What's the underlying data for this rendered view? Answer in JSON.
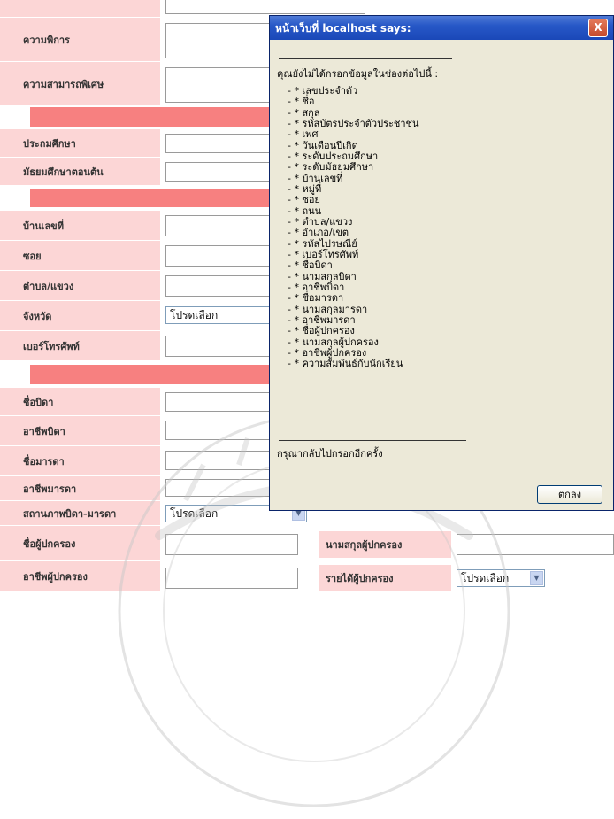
{
  "form": {
    "labels": {
      "disability": "ความพิการ",
      "special_ability": "ความสามารถพิเศษ",
      "primary": "ประถมศึกษา",
      "lower_secondary": "มัธยมศึกษาตอนต้น",
      "house_no": "บ้านเลขที่",
      "soi": "ซอย",
      "subdistrict": "ตำบล/แขวง",
      "province": "จังหวัด",
      "phone": "เบอร์โทรศัพท์",
      "father_name": "ชื่อบิดา",
      "father_occupation": "อาชีพบิดา",
      "mother_name": "ชื่อมารดา",
      "mother_occupation": "อาชีพมารดา",
      "parents_status": "สถานภาพบิดา-มารดา",
      "guardian_name": "ชื่อผู้ปกครอง",
      "guardian_surname": "นามสกุลผู้ปกครอง",
      "guardian_occupation": "อาชีพผู้ปกครอง",
      "guardian_income": "รายได้ผู้ปกครอง"
    },
    "select_placeholder": "โปรดเลือก"
  },
  "dialog": {
    "title": "หน้าเว็บที่ localhost says:",
    "close_label": "X",
    "intro": "คุณยังไม่ได้กรอกข้อมูลในช่องต่อไปนี้ :",
    "items": [
      "- * เลขประจำตัว",
      "- * ชื่อ",
      "- * สกุล",
      "- * รหัสบัตรประจำตัวประชาชน",
      "- * เพศ",
      "- * วันเดือนปีเกิด",
      "- * ระดับประถมศึกษา",
      "- * ระดับมัธยมศึกษา",
      "- * บ้านเลขที่",
      "- * หมู่ที่",
      "- * ซอย",
      "- * ถนน",
      "- * ตำบล/แขวง",
      "- * อำเภอ/เขต",
      "- * รหัสไปรษณีย์",
      "- * เบอร์โทรศัพท์",
      "- * ชื่อบิดา",
      "- * นามสกุลบิดา",
      "- * อาชีพบิดา",
      "- * ชื่อมารดา",
      "- * นามสกุลมารดา",
      "- * อาชีพมารดา",
      "- * ชื่อผู้ปกครอง",
      "- * นามสกุลผู้ปกครอง",
      "- * อาชีพผู้ปกครอง",
      "- * ความสัมพันธ์กับนักเรียน"
    ],
    "footer": "กรุณากลับไปกรอกอีกครั้ง",
    "ok_label": "ตกลง"
  },
  "colors": {
    "label_bg": "#fcd6d6",
    "section_bar": "#f78080",
    "titlebar": "#2758c7",
    "dialog_bg": "#ece9d8"
  }
}
